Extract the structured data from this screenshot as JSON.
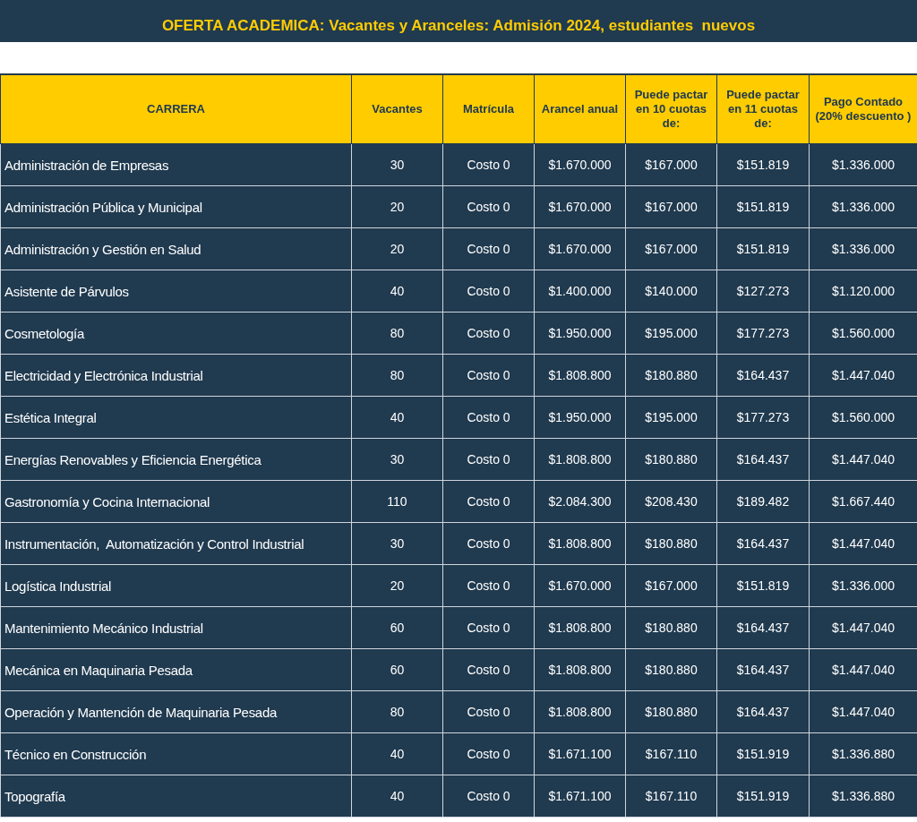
{
  "title": "OFERTA ACADEMICA: Vacantes y Aranceles: Admisión 2024, estudiantes  nuevos",
  "table": {
    "columns": [
      "CARRERA",
      "Vacantes",
      "Matrícula",
      "Arancel anual",
      "Puede pactar en 10 cuotas de:",
      "Puede pactar en 11 cuotas de:",
      "Pago Contado (20% descuento )"
    ],
    "rows": [
      [
        "Administración de Empresas",
        "30",
        "Costo 0",
        "$1.670.000",
        "$167.000",
        "$151.819",
        "$1.336.000"
      ],
      [
        "Administración Pública y Municipal",
        "20",
        "Costo 0",
        "$1.670.000",
        "$167.000",
        "$151.819",
        "$1.336.000"
      ],
      [
        "Administración y Gestión en Salud",
        "20",
        "Costo 0",
        "$1.670.000",
        "$167.000",
        "$151.819",
        "$1.336.000"
      ],
      [
        "Asistente de Párvulos",
        "40",
        "Costo 0",
        "$1.400.000",
        "$140.000",
        "$127.273",
        "$1.120.000"
      ],
      [
        "Cosmetología",
        "80",
        "Costo 0",
        "$1.950.000",
        "$195.000",
        "$177.273",
        "$1.560.000"
      ],
      [
        "Electricidad y Electrónica Industrial",
        "80",
        "Costo 0",
        "$1.808.800",
        "$180.880",
        "$164.437",
        "$1.447.040"
      ],
      [
        "Estética Integral",
        "40",
        "Costo 0",
        "$1.950.000",
        "$195.000",
        "$177.273",
        "$1.560.000"
      ],
      [
        "Energías Renovables y Eficiencia Energética",
        "30",
        "Costo 0",
        "$1.808.800",
        "$180.880",
        "$164.437",
        "$1.447.040"
      ],
      [
        "Gastronomía y Cocina Internacional",
        "110",
        "Costo 0",
        "$2.084.300",
        "$208.430",
        "$189.482",
        "$1.667.440"
      ],
      [
        "Instrumentación,  Automatización y Control Industrial",
        "30",
        "Costo 0",
        "$1.808.800",
        "$180.880",
        "$164.437",
        "$1.447.040"
      ],
      [
        "Logística Industrial",
        "20",
        "Costo 0",
        "$1.670.000",
        "$167.000",
        "$151.819",
        "$1.336.000"
      ],
      [
        "Mantenimiento Mecánico Industrial",
        "60",
        "Costo 0",
        "$1.808.800",
        "$180.880",
        "$164.437",
        "$1.447.040"
      ],
      [
        "Mecánica en Maquinaria Pesada",
        "60",
        "Costo 0",
        "$1.808.800",
        "$180.880",
        "$164.437",
        "$1.447.040"
      ],
      [
        "Operación y Mantención de Maquinaria Pesada",
        "80",
        "Costo 0",
        "$1.808.800",
        "$180.880",
        "$164.437",
        "$1.447.040"
      ],
      [
        "Técnico en Construcción",
        "40",
        "Costo 0",
        "$1.671.100",
        "$167.110",
        "$151.919",
        "$1.336.880"
      ],
      [
        "Topografía",
        "40",
        "Costo 0",
        "$1.671.100",
        "$167.110",
        "$151.919",
        "$1.336.880"
      ]
    ]
  }
}
